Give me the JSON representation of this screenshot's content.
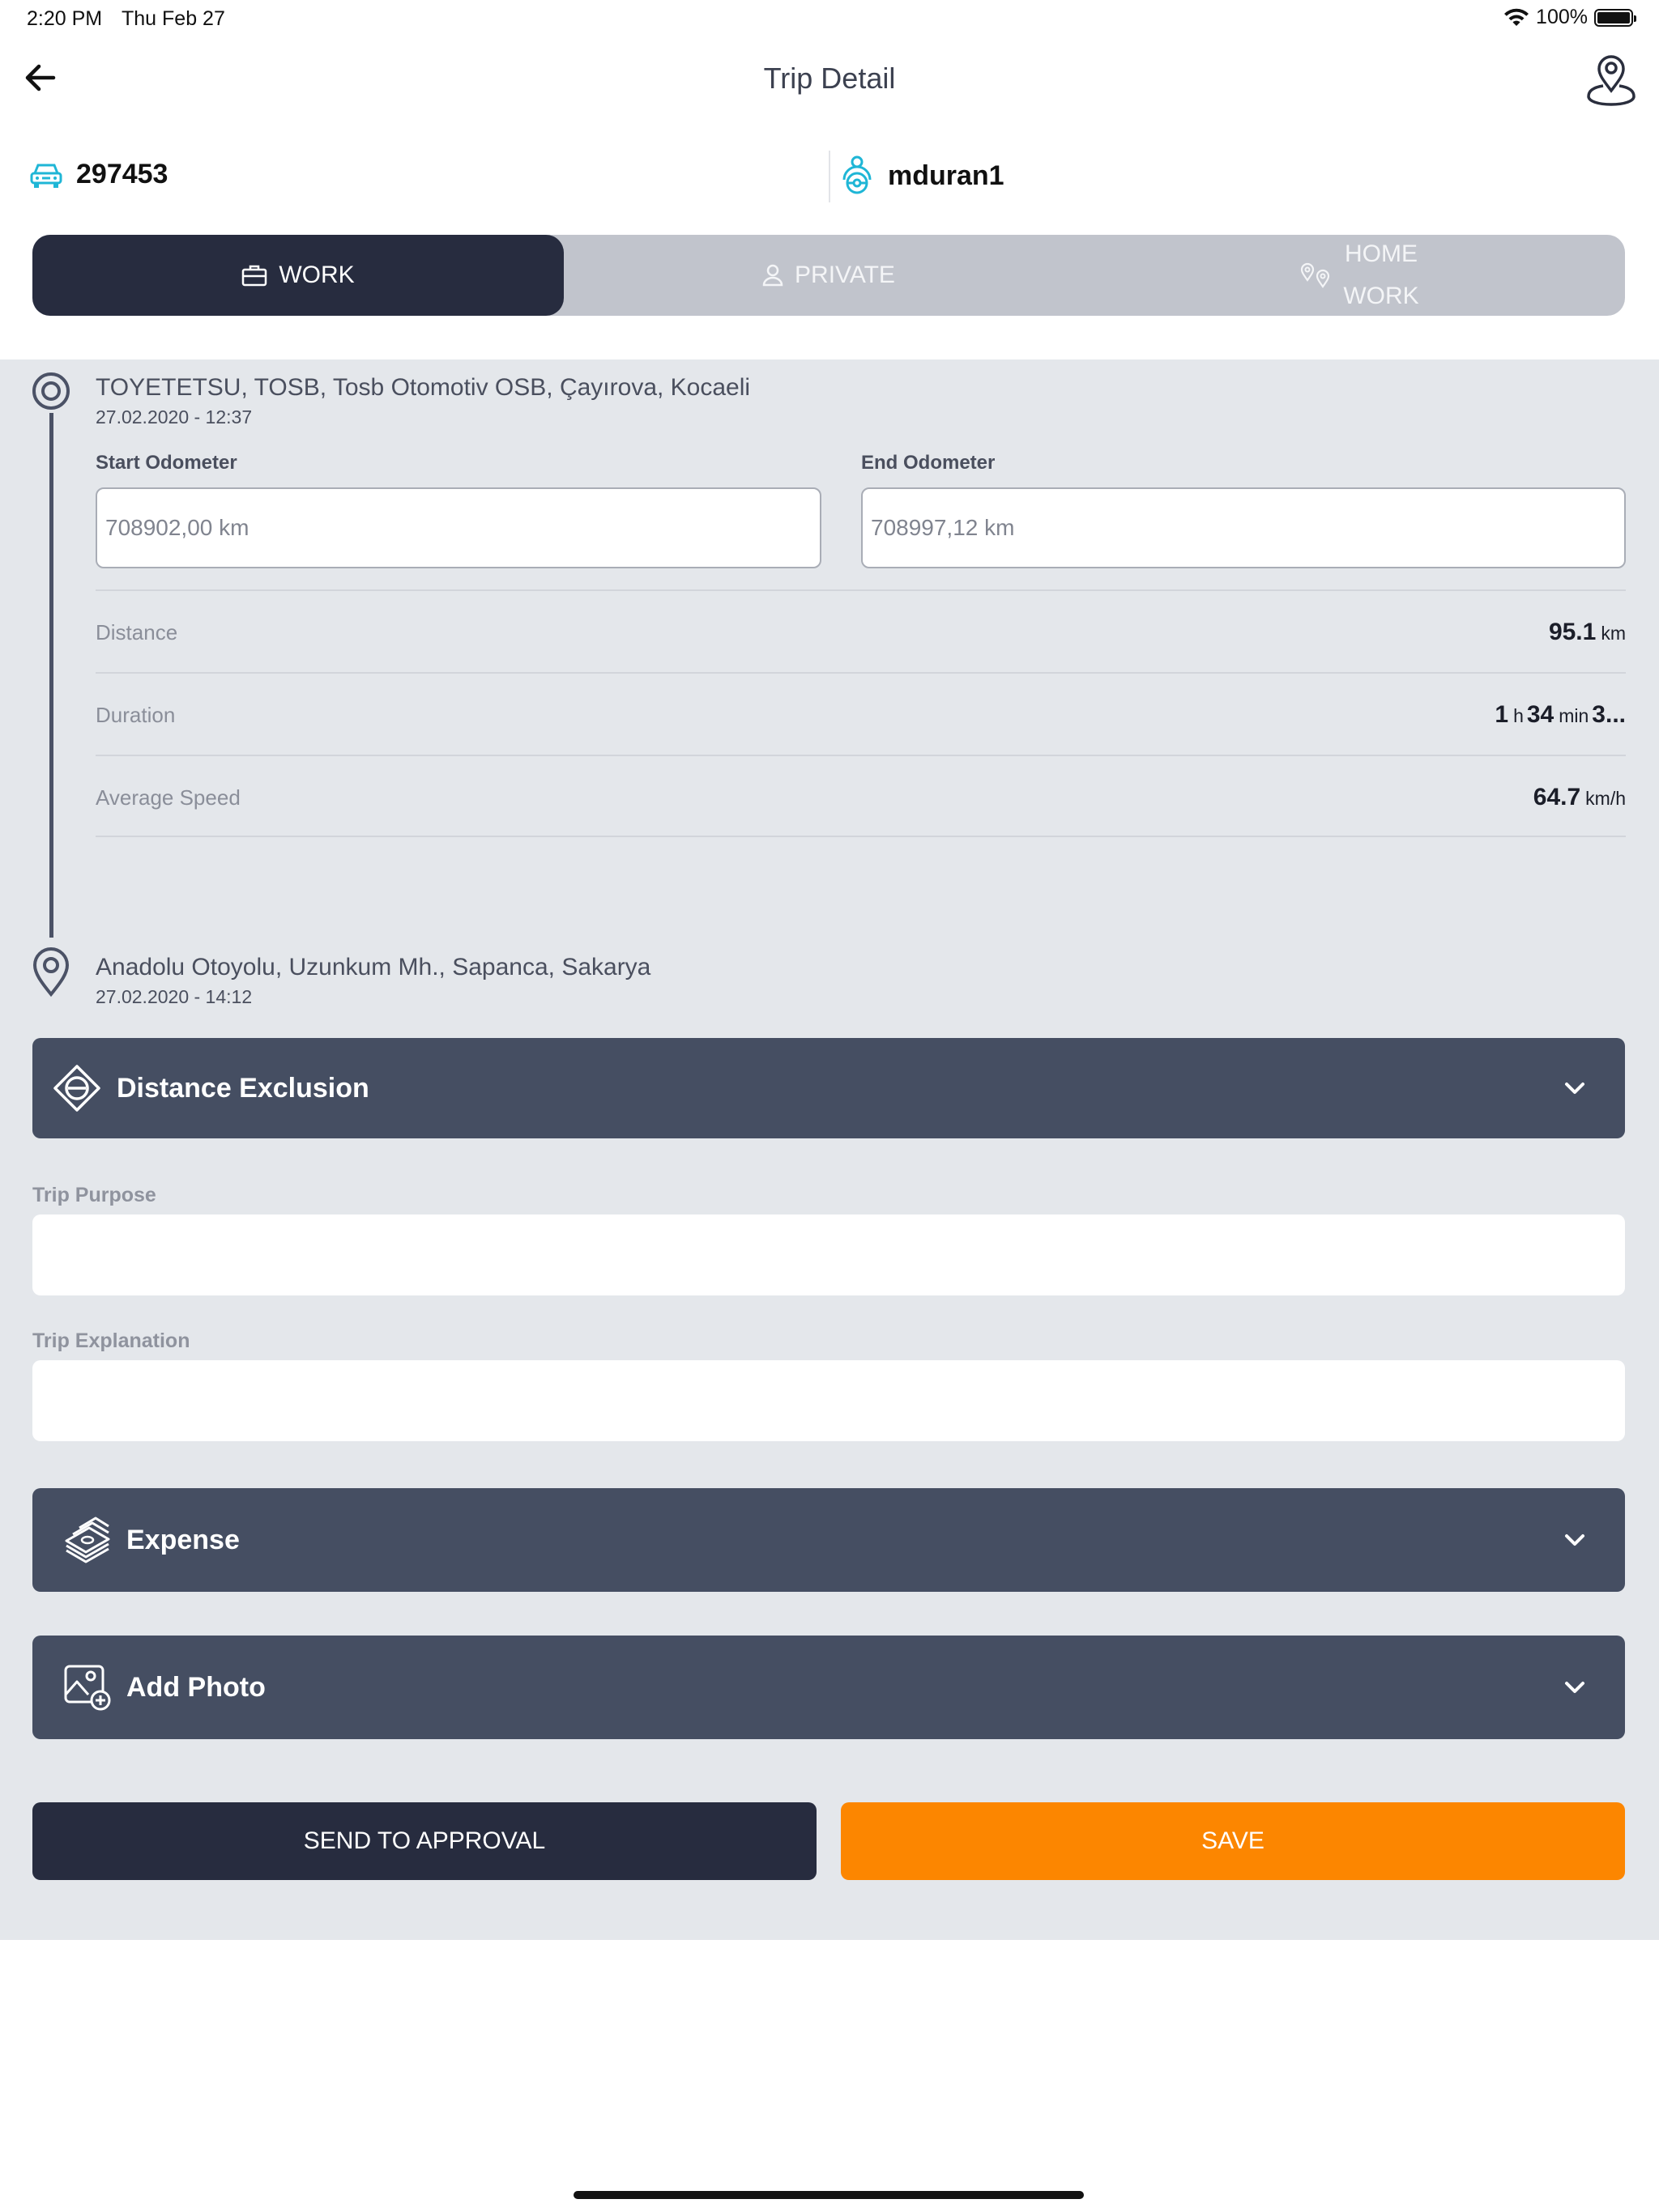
{
  "status_bar": {
    "time": "2:20 PM",
    "date": "Thu Feb 27",
    "battery": "100%"
  },
  "nav": {
    "title": "Trip Detail",
    "back_icon": "arrow-left-icon",
    "profile_icon": "user-location-icon"
  },
  "trip_header": {
    "vehicle_plate": "297453",
    "driver_name": "mduran1",
    "accent_color": "#1fb6d6"
  },
  "tabs": {
    "work": "WORK",
    "private": "PRIVATE",
    "home_line1": "HOME",
    "home_line2": "WORK",
    "active": "WORK"
  },
  "route": {
    "start_address": "TOYETETSU, TOSB, Tosb Otomotiv OSB, Çayırova, Kocaeli",
    "start_datetime": "27.02.2020 - 12:37",
    "end_address": "Anadolu Otoyolu, Uzunkum Mh., Sapanca, Sakarya",
    "end_datetime": "27.02.2020 - 14:12"
  },
  "odometer": {
    "start_label": "Start Odometer",
    "start_value": "708902,00 km",
    "end_label": "End Odometer",
    "end_value": "708997,12 km"
  },
  "stats": {
    "distance_label": "Distance",
    "distance_value": "95.1",
    "distance_unit": "km",
    "duration_label": "Duration",
    "duration_hours": "1",
    "duration_h_unit": "h",
    "duration_minutes": "34",
    "duration_min_unit": "min",
    "duration_rest": "3...",
    "speed_label": "Average Speed",
    "speed_value": "64.7",
    "speed_unit": "km/h"
  },
  "sections": {
    "distance_exclusion": "Distance Exclusion",
    "expense": "Expense",
    "add_photo": "Add Photo"
  },
  "form": {
    "trip_purpose_label": "Trip Purpose",
    "trip_purpose_value": "",
    "trip_explanation_label": "Trip Explanation",
    "trip_explanation_value": ""
  },
  "actions": {
    "send_to_approval": "SEND TO APPROVAL",
    "save": "SAVE",
    "save_color": "#fc8600"
  }
}
